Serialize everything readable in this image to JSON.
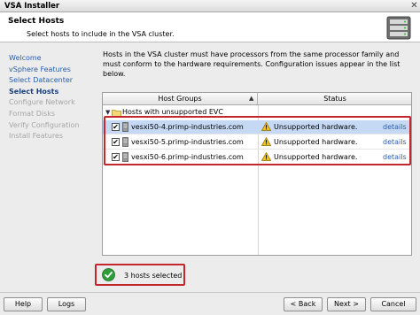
{
  "window": {
    "title": "VSA Installer",
    "close_glyph": "✕"
  },
  "header": {
    "title": "Select Hosts",
    "subtitle": "Select hosts to include in the VSA cluster.",
    "icon": "server-rack-icon"
  },
  "nav": {
    "items": [
      {
        "label": "Welcome",
        "state": "done"
      },
      {
        "label": "vSphere Features",
        "state": "done"
      },
      {
        "label": "Select Datacenter",
        "state": "done"
      },
      {
        "label": "Select Hosts",
        "state": "current"
      },
      {
        "label": "Configure Network",
        "state": "future"
      },
      {
        "label": "Format Disks",
        "state": "future"
      },
      {
        "label": "Verify Configuration",
        "state": "future"
      },
      {
        "label": "Install Features",
        "state": "future"
      }
    ]
  },
  "description": "Hosts in the VSA cluster must have processors from the same processor family and must conform to the hardware requirements. Configuration issues appear in the list below.",
  "grid": {
    "columns": {
      "host_groups": "Host Groups",
      "status": "Status",
      "sort_glyph": "▲"
    },
    "group": {
      "label": "Hosts with unsupported EVC",
      "expander": "▼",
      "icon": "folder-icon"
    },
    "hosts": [
      {
        "name": "vesxi50-4.primp-industries.com",
        "checked": true,
        "selected": true,
        "status": "Unsupported hardware.",
        "link": "details"
      },
      {
        "name": "vesxi50-5.primp-industries.com",
        "checked": true,
        "selected": false,
        "status": "Unsupported hardware.",
        "link": "details"
      },
      {
        "name": "vesxi50-6.primp-industries.com",
        "checked": true,
        "selected": false,
        "status": "Unsupported hardware.",
        "link": "details"
      }
    ],
    "check_glyph": "✔"
  },
  "selection_status": {
    "text": "3 hosts selected",
    "icon": "check-circle-icon"
  },
  "buttons": {
    "help": "Help",
    "logs": "Logs",
    "back": "< Back",
    "next": "Next >",
    "cancel": "Cancel"
  },
  "colors": {
    "highlight_box": "#c3262c",
    "selection": "#c5d8f4",
    "link": "#2a5ea8",
    "ok_green": "#2f9e3a",
    "warning": "#f2c21a"
  }
}
